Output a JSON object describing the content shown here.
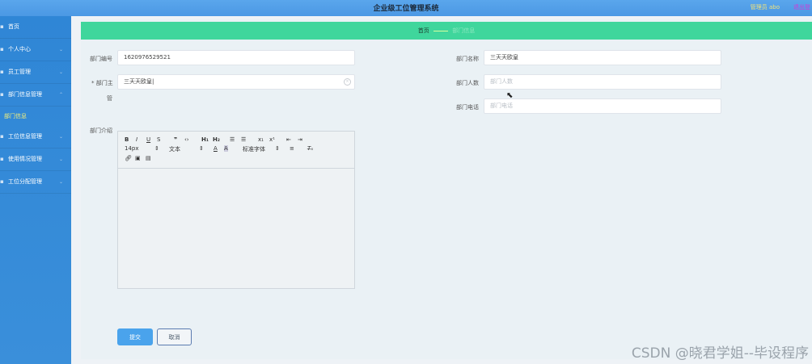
{
  "header": {
    "title": "企业级工位管理系统",
    "admin_label": "管理员 abo",
    "logout_label": "退出登"
  },
  "sidebar": {
    "items": [
      {
        "label": "首页"
      },
      {
        "label": "个人中心"
      },
      {
        "label": "员工管理"
      },
      {
        "label": "部门信息管理"
      },
      {
        "label": "工位信息管理"
      },
      {
        "label": "使用情况管理"
      },
      {
        "label": "工位分配管理"
      }
    ],
    "active_sub": "部门信息"
  },
  "breadcrumb": {
    "home": "首页",
    "current": "部门信息"
  },
  "form": {
    "dept_no_label": "部门编号",
    "dept_no_value": "1620976529521",
    "dept_name_label": "部门名称",
    "dept_name_value": "三天天欧皇",
    "manager_label_part1": "* 部门主",
    "manager_label_part2": "管",
    "manager_value": "三天天欧皇",
    "count_label": "部门人数",
    "count_placeholder": "部门人数",
    "phone_label": "部门电话",
    "phone_placeholder": "部门电话",
    "intro_label": "部门介绍"
  },
  "editor": {
    "font_size": "14px",
    "text_type": "文本",
    "font_family": "标准字体"
  },
  "buttons": {
    "submit": "提交",
    "cancel": "取消"
  },
  "watermark": "CSDN @晓君学姐--毕设程序"
}
